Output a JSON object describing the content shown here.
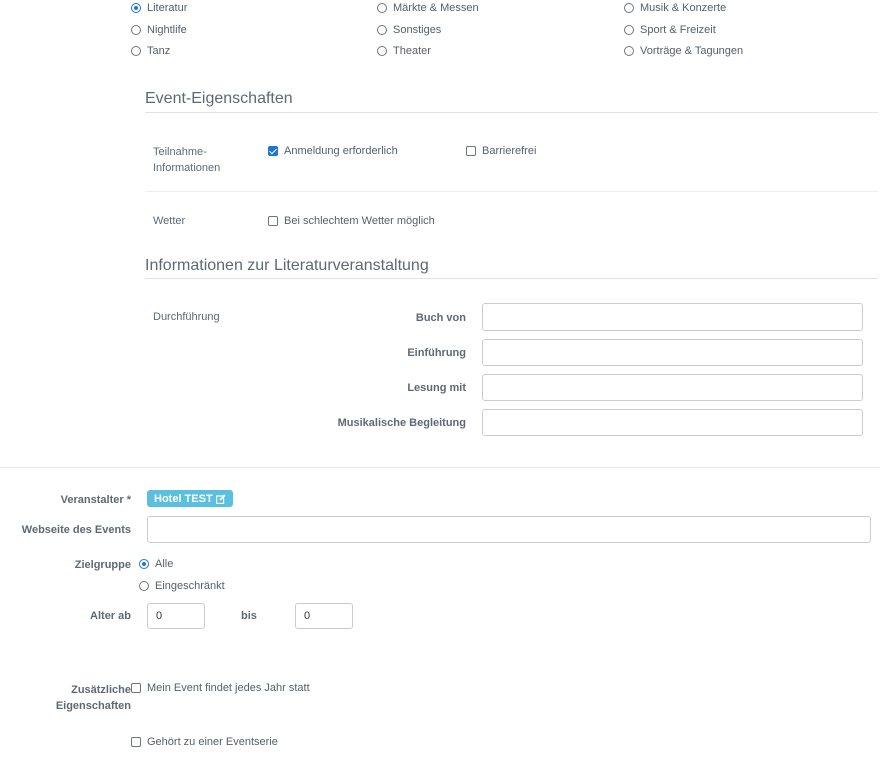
{
  "categories": {
    "col1": [
      {
        "label": "Literatur",
        "checked": true
      },
      {
        "label": "Nightlife",
        "checked": false
      },
      {
        "label": "Tanz",
        "checked": false
      }
    ],
    "col2": [
      {
        "label": "Märkte & Messen",
        "checked": false
      },
      {
        "label": "Sonstiges",
        "checked": false
      },
      {
        "label": "Theater",
        "checked": false
      }
    ],
    "col3": [
      {
        "label": "Musik & Konzerte",
        "checked": false
      },
      {
        "label": "Sport & Freizeit",
        "checked": false
      },
      {
        "label": "Vorträge & Tagungen",
        "checked": false
      }
    ]
  },
  "event_props": {
    "title": "Event-Eigenschaften",
    "teilnahme_label_1": "Teilnahme-",
    "teilnahme_label_2": "Informationen",
    "anmeldung": "Anmeldung erforderlich",
    "barrierefrei": "Barrierefrei",
    "wetter_label": "Wetter",
    "schlechtes_wetter": "Bei schlechtem Wetter möglich"
  },
  "literatur": {
    "title": "Informationen zur Literaturveranstaltung",
    "durchfuehrung": "Durchführung",
    "buch_von": "Buch von",
    "einfuehrung": "Einführung",
    "lesung_mit": "Lesung mit",
    "musik_begleitung": "Musikalische Begleitung"
  },
  "form": {
    "veranstalter_label": "Veranstalter *",
    "veranstalter_value": "Hotel TEST",
    "webseite_label": "Webseite des Events",
    "zielgruppe_label": "Zielgruppe",
    "zielgruppe_alle": "Alle",
    "zielgruppe_eingeschraenkt": "Eingeschränkt",
    "alter_ab_label": "Alter ab",
    "alter_ab_value": "0",
    "bis_label": "bis",
    "bis_value": "0",
    "zusaetzliche_label_1": "Zusätzliche",
    "zusaetzliche_label_2": "Eigenschaften",
    "jedes_jahr": "Mein Event findet jedes Jahr statt",
    "eventserie": "Gehört zu einer Eventserie"
  },
  "colors": {
    "accent": "#1f75d1",
    "badge": "#5bc0de"
  }
}
